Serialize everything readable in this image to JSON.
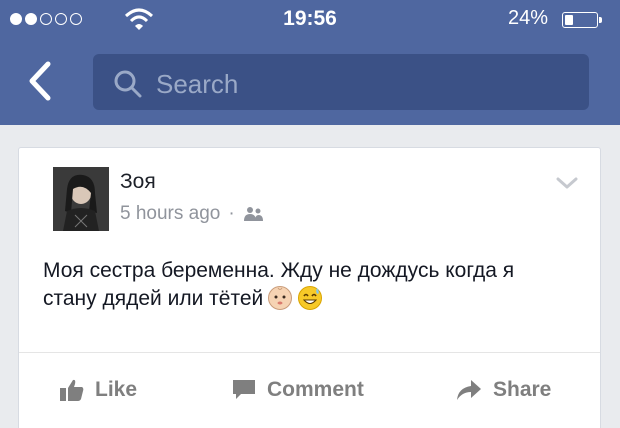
{
  "status_bar": {
    "time": "19:56",
    "battery_percent": "24%",
    "signal_bars_filled": 2,
    "signal_bars_total": 5
  },
  "nav": {
    "search_placeholder": "Search"
  },
  "post": {
    "author": "Зоя",
    "timestamp": "5 hours ago",
    "separator": "·",
    "text": "Моя сестра беременна. Жду не дождусь когда я стану дядей или тётей",
    "actions": {
      "like": "Like",
      "comment": "Comment",
      "share": "Share"
    }
  },
  "colors": {
    "header": "#4f67a0",
    "search_bg": "#3b5186",
    "action_text": "#7f7f7f"
  }
}
